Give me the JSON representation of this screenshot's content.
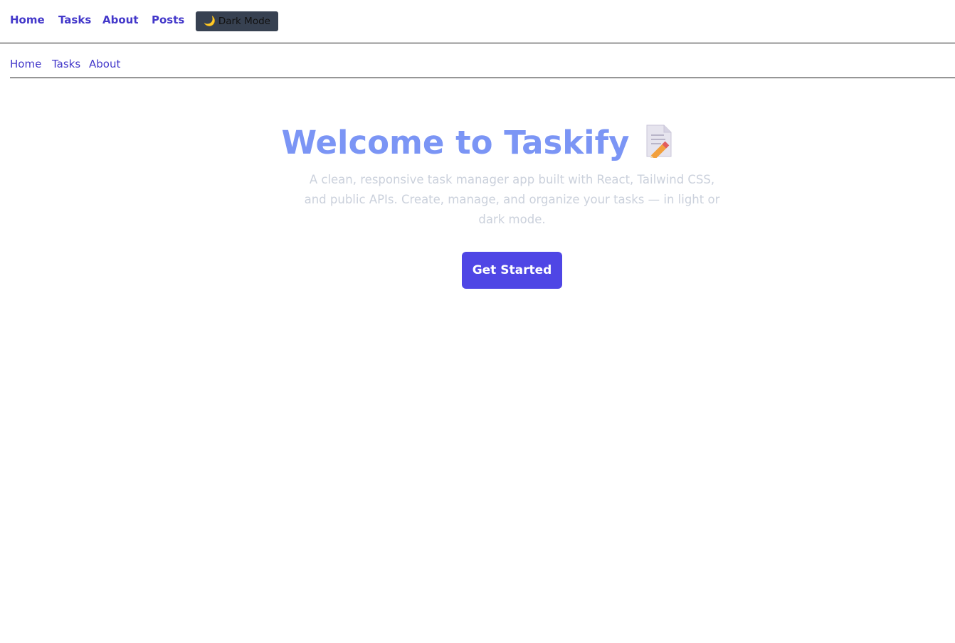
{
  "topnav": {
    "links": [
      {
        "label": "Home"
      },
      {
        "label": "Tasks"
      },
      {
        "label": "About"
      },
      {
        "label": "Posts"
      }
    ],
    "theme_toggle": {
      "icon": "moon-icon",
      "icon_glyph": "🌙",
      "label": "Dark Mode"
    }
  },
  "subnav": {
    "links": [
      {
        "label": "Home"
      },
      {
        "label": "Tasks"
      },
      {
        "label": "About"
      }
    ]
  },
  "hero": {
    "title": "Welcome to Taskify",
    "title_icon": "memo-pencil-icon",
    "subtitle": "A clean, responsive task manager app built with React, Tailwind CSS, and public APIs. Create, manage, and organize your tasks — in light or dark mode.",
    "cta_label": "Get Started"
  },
  "colors": {
    "link": "#4338ca",
    "title": "#7b95f5",
    "subtitle": "#cbd1dc",
    "cta": "#4f46e5",
    "theme_button": "#374151"
  }
}
